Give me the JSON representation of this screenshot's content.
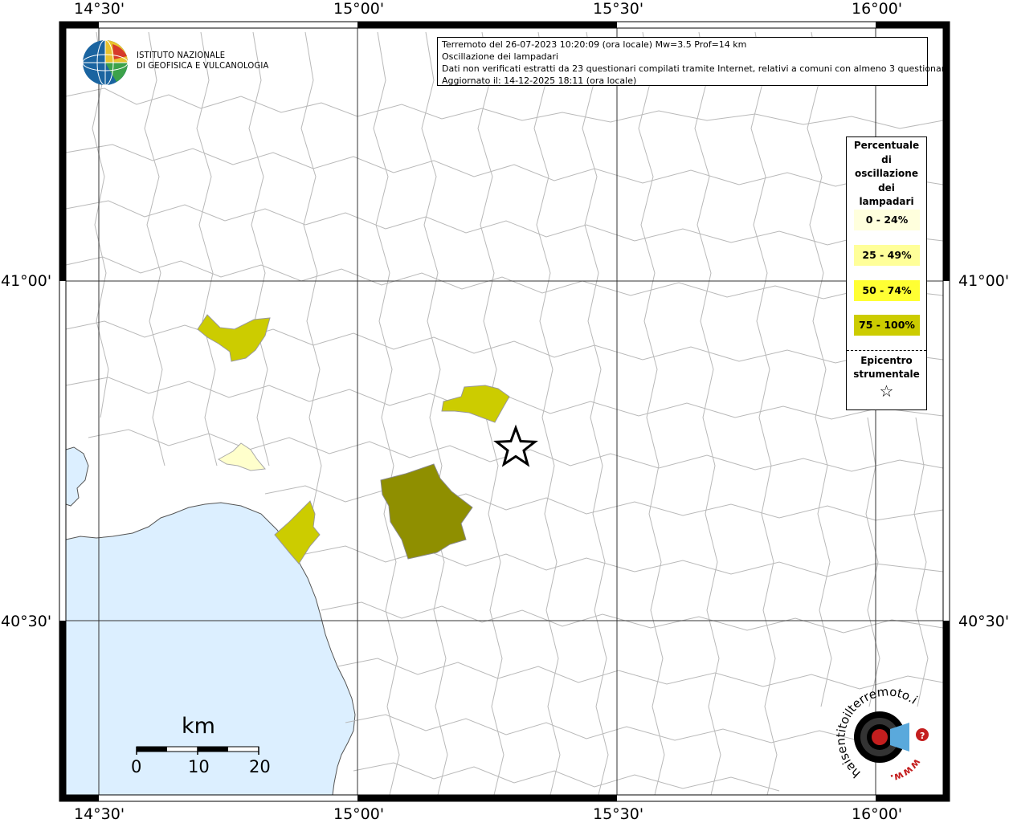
{
  "title_box": {
    "line1": "Terremoto del 26-07-2023 10:20:09 (ora locale) Mw=3.5 Prof=14 km",
    "line2": "Oscillazione dei lampadari",
    "line3": "Dati non verificati estratti da 23 questionari compilati tramite Internet, relativi a comuni con almeno 3 questionari.",
    "line4": "Aggiornato il: 14-12-2025 18:11 (ora locale)"
  },
  "institute": {
    "line1": "ISTITUTO NAZIONALE",
    "line2": "DI GEOFISICA E VULCANOLOGIA"
  },
  "coordinates": {
    "lon_ticks": [
      "14°30'",
      "15°00'",
      "15°30'",
      "16°00'"
    ],
    "lat_ticks": [
      "41°00'",
      "40°30'"
    ]
  },
  "legend": {
    "title_lines": [
      "Percentuale",
      "di",
      "oscillazione",
      "dei",
      "lampadari"
    ],
    "items": [
      {
        "label": "0 - 24%",
        "color": "#ffffdd"
      },
      {
        "label": "25 - 49%",
        "color": "#ffff99"
      },
      {
        "label": "50 - 74%",
        "color": "#ffff33"
      },
      {
        "label": "75 - 100%",
        "color": "#cccc00"
      }
    ],
    "epicenter_lines": [
      "Epicentro",
      "strumentale"
    ],
    "epicenter_symbol": "☆"
  },
  "scale_bar": {
    "unit": "km",
    "labels": [
      "0",
      "10",
      "20"
    ]
  },
  "colors": {
    "sea": "#dcefff",
    "border": "#c8c8c8",
    "fill_low": "#ffffcc",
    "fill_mid": "#cccc00",
    "fill_high": "#8f8f00"
  },
  "badge": {
    "text": "haisentitoilterremoto.it",
    "www": "www."
  }
}
